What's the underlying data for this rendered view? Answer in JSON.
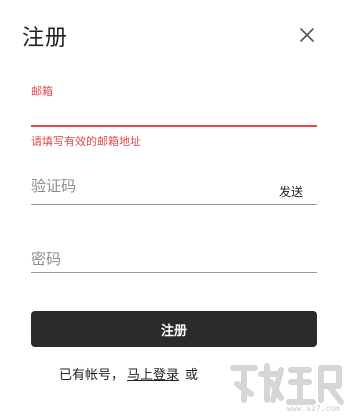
{
  "dialog": {
    "title": "注册",
    "close_icon": "close-icon"
  },
  "email": {
    "label": "邮箱",
    "value": "",
    "error": "请填写有效的邮箱地址",
    "accent_color": "#e0494c"
  },
  "code": {
    "placeholder": "验证码",
    "send_label": "发送"
  },
  "password": {
    "placeholder": "密码"
  },
  "submit": {
    "label": "注册",
    "color": "#2b2b2b"
  },
  "footer": {
    "prefix": "已有帐号，",
    "login_link": "马上登录",
    "suffix": "或"
  },
  "watermark": {
    "text": "www.xz7.com"
  }
}
